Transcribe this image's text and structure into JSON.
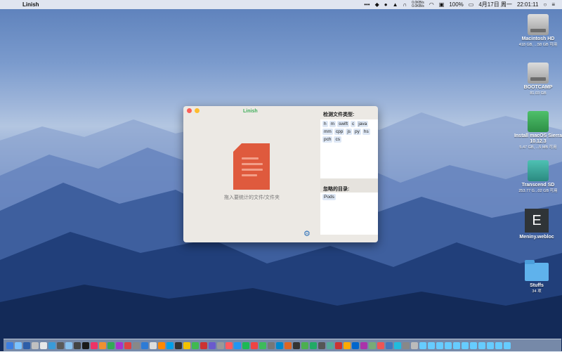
{
  "menubar": {
    "apple_glyph": "",
    "app_name": "Linish",
    "net_up": "0.0KB/s",
    "net_down": "0.0KB/s",
    "battery": "100%",
    "date": "4月17日 周一",
    "time": "22:01:11"
  },
  "desktop_icons": [
    {
      "label": "Macintosh HD",
      "sub": "418 GB, ...58 GB 可用"
    },
    {
      "label": "BOOTCAMP",
      "sub": "81.03 GB"
    },
    {
      "label": "Install macOS Sierra 10.12.3",
      "sub": "5.47 GB, ...5 MB 可用"
    },
    {
      "label": "Transcend SD",
      "sub": "253.77 G...02 GB 可用"
    },
    {
      "label": "Meniny.webloc",
      "sub": "",
      "glyph": "E"
    },
    {
      "label": "Stuffs",
      "sub": "34 项"
    }
  ],
  "window": {
    "title": "Linish",
    "drop_hint": "拖入要统计的文件/文件夹",
    "file_types_label": "检测文件类型:",
    "file_types": [
      "h",
      "m",
      "swift",
      "c",
      "java",
      "mm",
      "cpp",
      "js",
      "py",
      "hs",
      "pch",
      "cs"
    ],
    "ignore_label": "忽略的目录:",
    "ignored_dirs": [
      "Pods"
    ],
    "settings_icon": "gear-icon"
  },
  "colors": {
    "accent": "#3fae5a",
    "doc_icon": "#df5a3d",
    "tag_bg": "#dde7f5"
  }
}
